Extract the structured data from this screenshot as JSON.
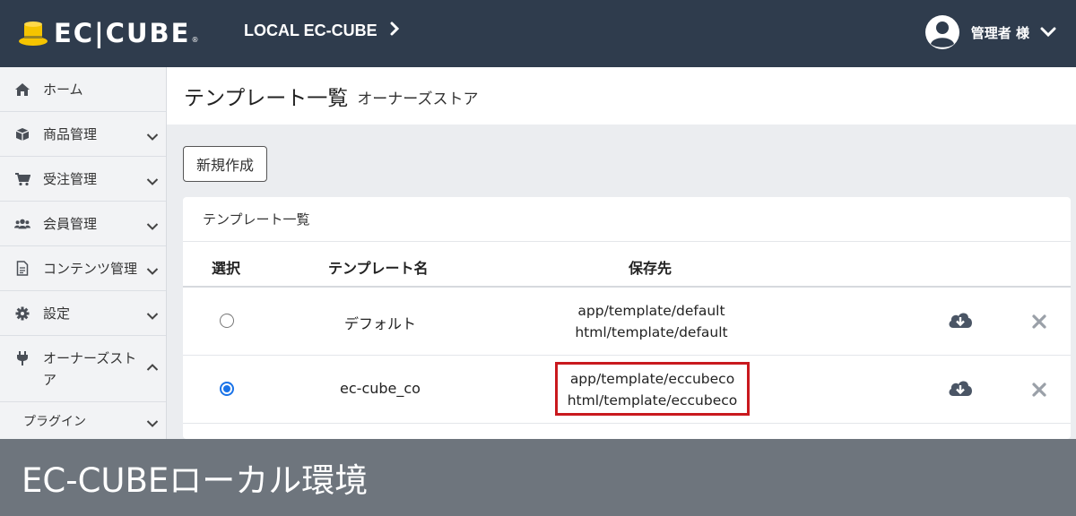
{
  "header": {
    "logo_text": "EC|CUBE",
    "shop_name": "LOCAL EC-CUBE",
    "user_name": "管理者 様"
  },
  "sidebar": {
    "items": [
      {
        "label": "ホーム",
        "icon": "home-icon"
      },
      {
        "label": "商品管理",
        "icon": "cube-icon"
      },
      {
        "label": "受注管理",
        "icon": "cart-icon"
      },
      {
        "label": "会員管理",
        "icon": "users-icon"
      },
      {
        "label": "コンテンツ管理",
        "icon": "file-icon"
      },
      {
        "label": "設定",
        "icon": "cog-icon"
      },
      {
        "label": "オーナーズストア",
        "icon": "plug-icon"
      }
    ],
    "sub_items": [
      {
        "label": "プラグイン"
      }
    ]
  },
  "page": {
    "title": "テンプレート一覧",
    "subtitle": "オーナーズストア",
    "new_button": "新規作成"
  },
  "card": {
    "title": "テンプレート一覧",
    "columns": [
      "選択",
      "テンプレート名",
      "保存先"
    ],
    "rows": [
      {
        "selected": false,
        "name": "デフォルト",
        "path_app": "app/template/default",
        "path_html": "html/template/default"
      },
      {
        "selected": true,
        "name": "ec-cube_co",
        "path_app": "app/template/eccubeco",
        "path_html": "html/template/eccubeco"
      }
    ]
  },
  "caption": "EC-CUBEローカル環境",
  "colors": {
    "header_bg": "#2f3c4d",
    "logo_accent": "#f5c400",
    "highlight_border": "#c9191e",
    "radio_selected": "#1a73e8",
    "caption_bg": "#6e757d"
  }
}
